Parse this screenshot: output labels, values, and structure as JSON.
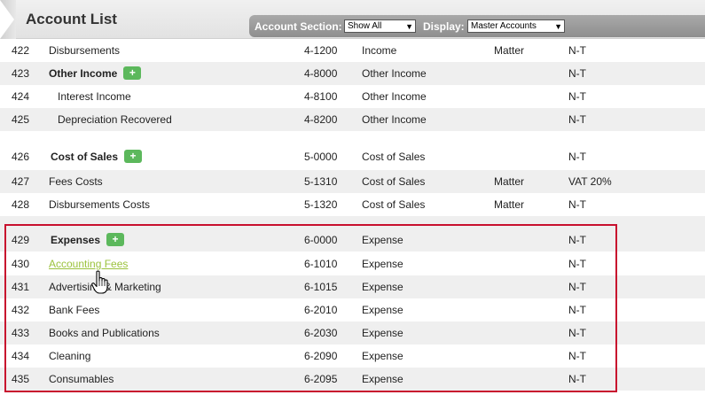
{
  "header": {
    "title": "Account List",
    "account_section_label": "Account Section:",
    "account_section_value": "Show All",
    "display_label": "Display:",
    "display_value": "Master Accounts"
  },
  "rows": [
    {
      "num": "422",
      "name": "Disbursements",
      "code": "4-1200",
      "type": "Income",
      "matter": "Matter",
      "tax": "N-T"
    },
    {
      "num": "423",
      "name": "Other Income",
      "code": "4-8000",
      "type": "Other Income",
      "matter": "",
      "tax": "N-T"
    },
    {
      "num": "424",
      "name": "Interest Income",
      "code": "4-8100",
      "type": "Other Income",
      "matter": "",
      "tax": "N-T"
    },
    {
      "num": "425",
      "name": "Depreciation Recovered",
      "code": "4-8200",
      "type": "Other Income",
      "matter": "",
      "tax": "N-T"
    },
    {
      "num": "426",
      "name": "Cost of Sales",
      "code": "5-0000",
      "type": "Cost of Sales",
      "matter": "",
      "tax": "N-T"
    },
    {
      "num": "427",
      "name": "Fees Costs",
      "code": "5-1310",
      "type": "Cost of Sales",
      "matter": "Matter",
      "tax": "VAT 20%"
    },
    {
      "num": "428",
      "name": "Disbursements Costs",
      "code": "5-1320",
      "type": "Cost of Sales",
      "matter": "Matter",
      "tax": "N-T"
    },
    {
      "num": "429",
      "name": "Expenses",
      "code": "6-0000",
      "type": "Expense",
      "matter": "",
      "tax": "N-T"
    },
    {
      "num": "430",
      "name": "Accounting Fees",
      "code": "6-1010",
      "type": "Expense",
      "matter": "",
      "tax": "N-T"
    },
    {
      "num": "431",
      "name": "Advertising & Marketing",
      "code": "6-1015",
      "type": "Expense",
      "matter": "",
      "tax": "N-T"
    },
    {
      "num": "432",
      "name": "Bank Fees",
      "code": "6-2010",
      "type": "Expense",
      "matter": "",
      "tax": "N-T"
    },
    {
      "num": "433",
      "name": "Books and Publications",
      "code": "6-2030",
      "type": "Expense",
      "matter": "",
      "tax": "N-T"
    },
    {
      "num": "434",
      "name": "Cleaning",
      "code": "6-2090",
      "type": "Expense",
      "matter": "",
      "tax": "N-T"
    },
    {
      "num": "435",
      "name": "Consumables",
      "code": "6-2095",
      "type": "Expense",
      "matter": "",
      "tax": "N-T"
    }
  ],
  "add_button_label": "+",
  "colors": {
    "header_bar": "#9a9a9a",
    "add_button": "#5cb85c",
    "link": "#9bc23c",
    "highlight_border": "#c8102e"
  }
}
